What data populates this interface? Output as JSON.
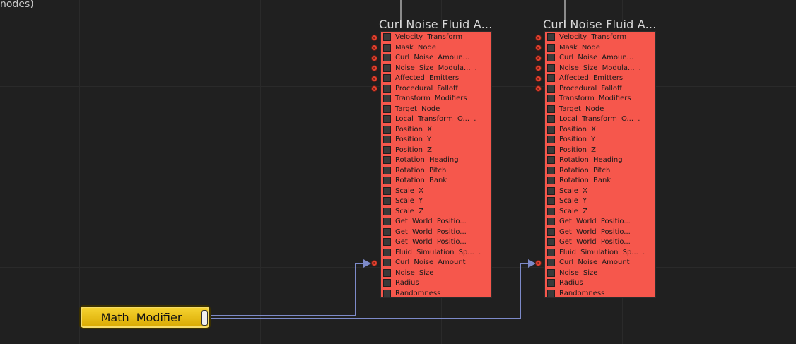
{
  "canvas": {
    "corner_text": "nodes)"
  },
  "nodes": [
    {
      "title": "Curl  Noise  Fluid  A...",
      "ports": [
        "Velocity  Transform",
        "Mask  Node",
        "Curl  Noise  Amoun...",
        "Noise  Size  Modula...  .",
        "Affected  Emitters",
        "Procedural  Falloff",
        "Transform  Modifiers",
        "Target  Node",
        "Local  Transform  O...  .",
        "Position  X",
        "Position  Y",
        "Position  Z",
        "Rotation  Heading",
        "Rotation  Pitch",
        "Rotation  Bank",
        "Scale  X",
        "Scale  Y",
        "Scale  Z",
        "Get  World  Positio...",
        "Get  World  Positio...",
        "Get  World  Positio...",
        "Fluid  Simulation  Sp...  .",
        "Curl  Noise  Amount",
        "Noise  Size",
        "Radius",
        "Randomness"
      ]
    },
    {
      "title": "Curl  Noise  Fluid  A...",
      "ports": [
        "Velocity  Transform",
        "Mask  Node",
        "Curl  Noise  Amoun...",
        "Noise  Size  Modula...  .",
        "Affected  Emitters",
        "Procedural  Falloff",
        "Transform  Modifiers",
        "Target  Node",
        "Local  Transform  O...  .",
        "Position  X",
        "Position  Y",
        "Position  Z",
        "Rotation  Heading",
        "Rotation  Pitch",
        "Rotation  Bank",
        "Scale  X",
        "Scale  Y",
        "Scale  Z",
        "Get  World  Positio...",
        "Get  World  Positio...",
        "Get  World  Positio...",
        "Fluid  Simulation  Sp...  .",
        "Curl  Noise  Amount",
        "Noise  Size",
        "Radius",
        "Randomness"
      ]
    }
  ],
  "math_modifier": {
    "label": "Math  Modifier"
  },
  "colors": {
    "background": "#202020",
    "node_body": "#f6574c",
    "math_node": "#e8c21a",
    "wire": "#7d8ac9",
    "connector": "#e2412f"
  },
  "icons": {
    "port_connector": "connector-icon",
    "port_toggle": "checkbox-icon"
  }
}
